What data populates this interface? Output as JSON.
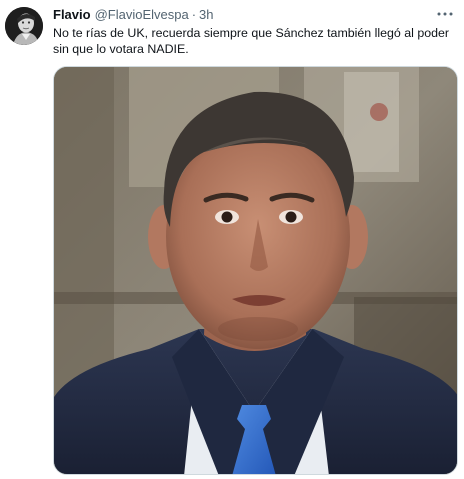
{
  "tweet": {
    "author_name": "Flavio",
    "author_handle": "@FlavioElvespa",
    "separator": "·",
    "timestamp": "3h",
    "text": "No te rías de UK, recuerda siempre que Sánchez también llegó al poder sin que lo votara NADIE.",
    "more_icon": "more-horizontal-icon",
    "avatar_icon": "user-avatar",
    "media_icon": "photo-man-in-suit"
  },
  "colors": {
    "text_primary": "#0f1419",
    "text_secondary": "#536471",
    "border": "#cfd9de",
    "tie": "#2e6fd0",
    "suit": "#232d45"
  }
}
